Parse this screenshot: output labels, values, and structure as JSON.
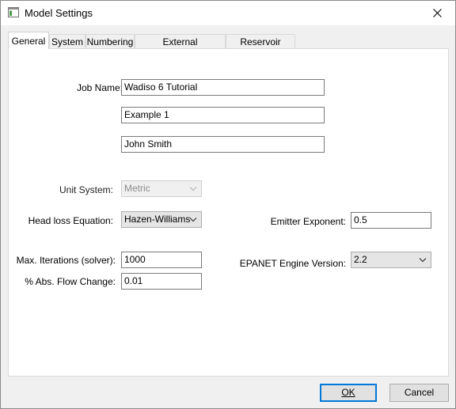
{
  "window": {
    "title": "Model Settings"
  },
  "tabs": [
    {
      "label": "General",
      "active": true
    },
    {
      "label": "System"
    },
    {
      "label": "Numbering"
    },
    {
      "label": "External Connections"
    },
    {
      "label": "Reservoir Zones"
    }
  ],
  "general": {
    "job_name_label": "Job Name:",
    "job_name_lines": [
      "Wadiso 6 Tutorial",
      "Example 1",
      "John Smith"
    ],
    "unit_system_label": "Unit System:",
    "unit_system_value": "Metric",
    "head_loss_label": "Head loss Equation:",
    "head_loss_value": "Hazen-Williams",
    "emitter_exponent_label": "Emitter Exponent:",
    "emitter_exponent_value": "0.5",
    "max_iterations_label": "Max. Iterations (solver):",
    "max_iterations_value": "1000",
    "flow_change_label": "% Abs. Flow Change:",
    "flow_change_value": "0.01",
    "epanet_version_label": "EPANET Engine Version:",
    "epanet_version_value": "2.2"
  },
  "footer": {
    "ok_label": "OK",
    "cancel_label": "Cancel"
  },
  "icons": {
    "app": "window-app-icon",
    "close": "close-icon",
    "dropdown": "chevron-down-icon"
  },
  "colors": {
    "accent": "#0078d7",
    "panel": "#ffffff",
    "dialog_bg": "#f0f0f0"
  }
}
